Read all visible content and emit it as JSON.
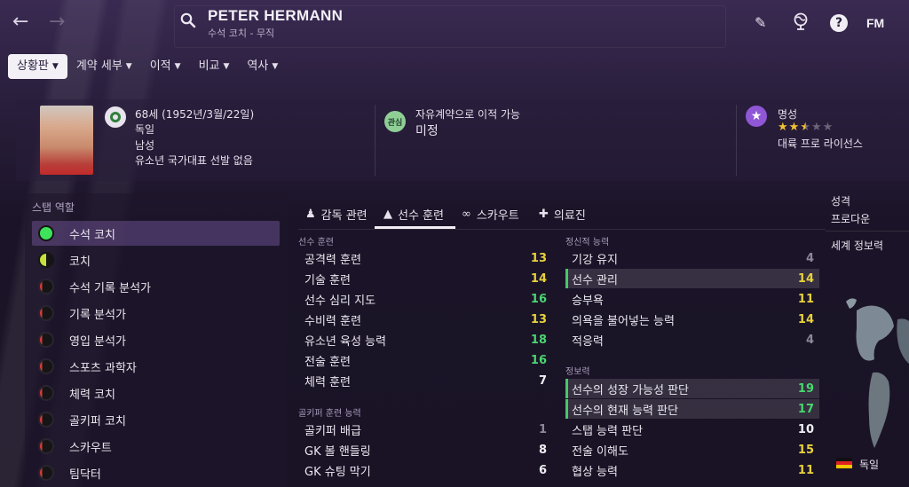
{
  "header": {
    "name": "PETER HERMANN",
    "subtitle": "수석 코치 - 무직",
    "back_icon": "←",
    "forward_icon": "→",
    "search_icon": "⚲",
    "edit_icon": "✎",
    "globe_icon": "◉",
    "help_icon": "?",
    "logo": "FM"
  },
  "tabs": [
    {
      "label": "상황판",
      "active": true
    },
    {
      "label": "계약 세부"
    },
    {
      "label": "이적"
    },
    {
      "label": "비교"
    },
    {
      "label": "역사"
    }
  ],
  "profile": {
    "age_dob": "68세 (1952년/3월/22일)",
    "nation": "독일",
    "gender": "남성",
    "youth_caps": "유소년 국가대표 선발 없음",
    "transfer_status": "자유계약으로 이적 가능",
    "interest_badge": "관심",
    "transfer_value": "미정",
    "reputation_label": "명성",
    "reputation_stars": 2.5,
    "license": "대륙 프로 라이선스"
  },
  "roles": {
    "title": "스탭 역할",
    "items": [
      {
        "label": "수석 코치",
        "level": "full",
        "active": true
      },
      {
        "label": "코치",
        "level": "half"
      },
      {
        "label": "수석 기록 분석가",
        "level": "low"
      },
      {
        "label": "기록 분석가",
        "level": "low"
      },
      {
        "label": "영입 분석가",
        "level": "low"
      },
      {
        "label": "스포츠 과학자",
        "level": "low"
      },
      {
        "label": "체력 코치",
        "level": "low"
      },
      {
        "label": "골키퍼 코치",
        "level": "low"
      },
      {
        "label": "스카우트",
        "level": "low"
      },
      {
        "label": "팀닥터",
        "level": "low"
      }
    ]
  },
  "section_tabs": [
    {
      "label": "감독 관련",
      "icon": "♟"
    },
    {
      "label": "선수 훈련",
      "icon": "▲",
      "active": true
    },
    {
      "label": "스카우트",
      "icon": "∞"
    },
    {
      "label": "의료진",
      "icon": "✚"
    }
  ],
  "coaching": {
    "label": "선수 훈련",
    "items": [
      {
        "label": "공격력 훈련",
        "value": "13",
        "color": "yellow"
      },
      {
        "label": "기술 훈련",
        "value": "14",
        "color": "yellow"
      },
      {
        "label": "선수 심리 지도",
        "value": "16",
        "color": "green"
      },
      {
        "label": "수비력 훈련",
        "value": "13",
        "color": "yellow"
      },
      {
        "label": "유소년 육성 능력",
        "value": "18",
        "color": "green"
      },
      {
        "label": "전술 훈련",
        "value": "16",
        "color": "green"
      },
      {
        "label": "체력 훈련",
        "value": "7",
        "color": "white"
      }
    ]
  },
  "goalkeeping": {
    "label": "골키퍼 훈련 능력",
    "items": [
      {
        "label": "골키퍼 배급",
        "value": "1",
        "color": "grey"
      },
      {
        "label": "GK 볼 핸들링",
        "value": "8",
        "color": "white"
      },
      {
        "label": "GK 슈팅 막기",
        "value": "6",
        "color": "white"
      }
    ]
  },
  "mental": {
    "label": "정신적 능력",
    "items": [
      {
        "label": "기강 유지",
        "value": "4",
        "color": "grey"
      },
      {
        "label": "선수 관리",
        "value": "14",
        "color": "yellow",
        "highlight": true
      },
      {
        "label": "승부욕",
        "value": "11",
        "color": "yellow"
      },
      {
        "label": "의욕을 불어넣는 능력",
        "value": "14",
        "color": "yellow"
      },
      {
        "label": "적응력",
        "value": "4",
        "color": "grey"
      }
    ]
  },
  "knowledge": {
    "label": "정보력",
    "items": [
      {
        "label": "선수의 성장 가능성 판단",
        "value": "19",
        "color": "green",
        "highlight": true
      },
      {
        "label": "선수의 현재 능력 판단",
        "value": "17",
        "color": "green",
        "highlight": true
      },
      {
        "label": "스탭 능력 판단",
        "value": "10",
        "color": "white"
      },
      {
        "label": "전술 이해도",
        "value": "15",
        "color": "yellow"
      },
      {
        "label": "협상 능력",
        "value": "11",
        "color": "yellow"
      }
    ]
  },
  "right_panel": {
    "personality_label": "성격",
    "personality_value": "프로다운",
    "world_knowledge_label": "세계 정보력",
    "nation": "독일"
  }
}
